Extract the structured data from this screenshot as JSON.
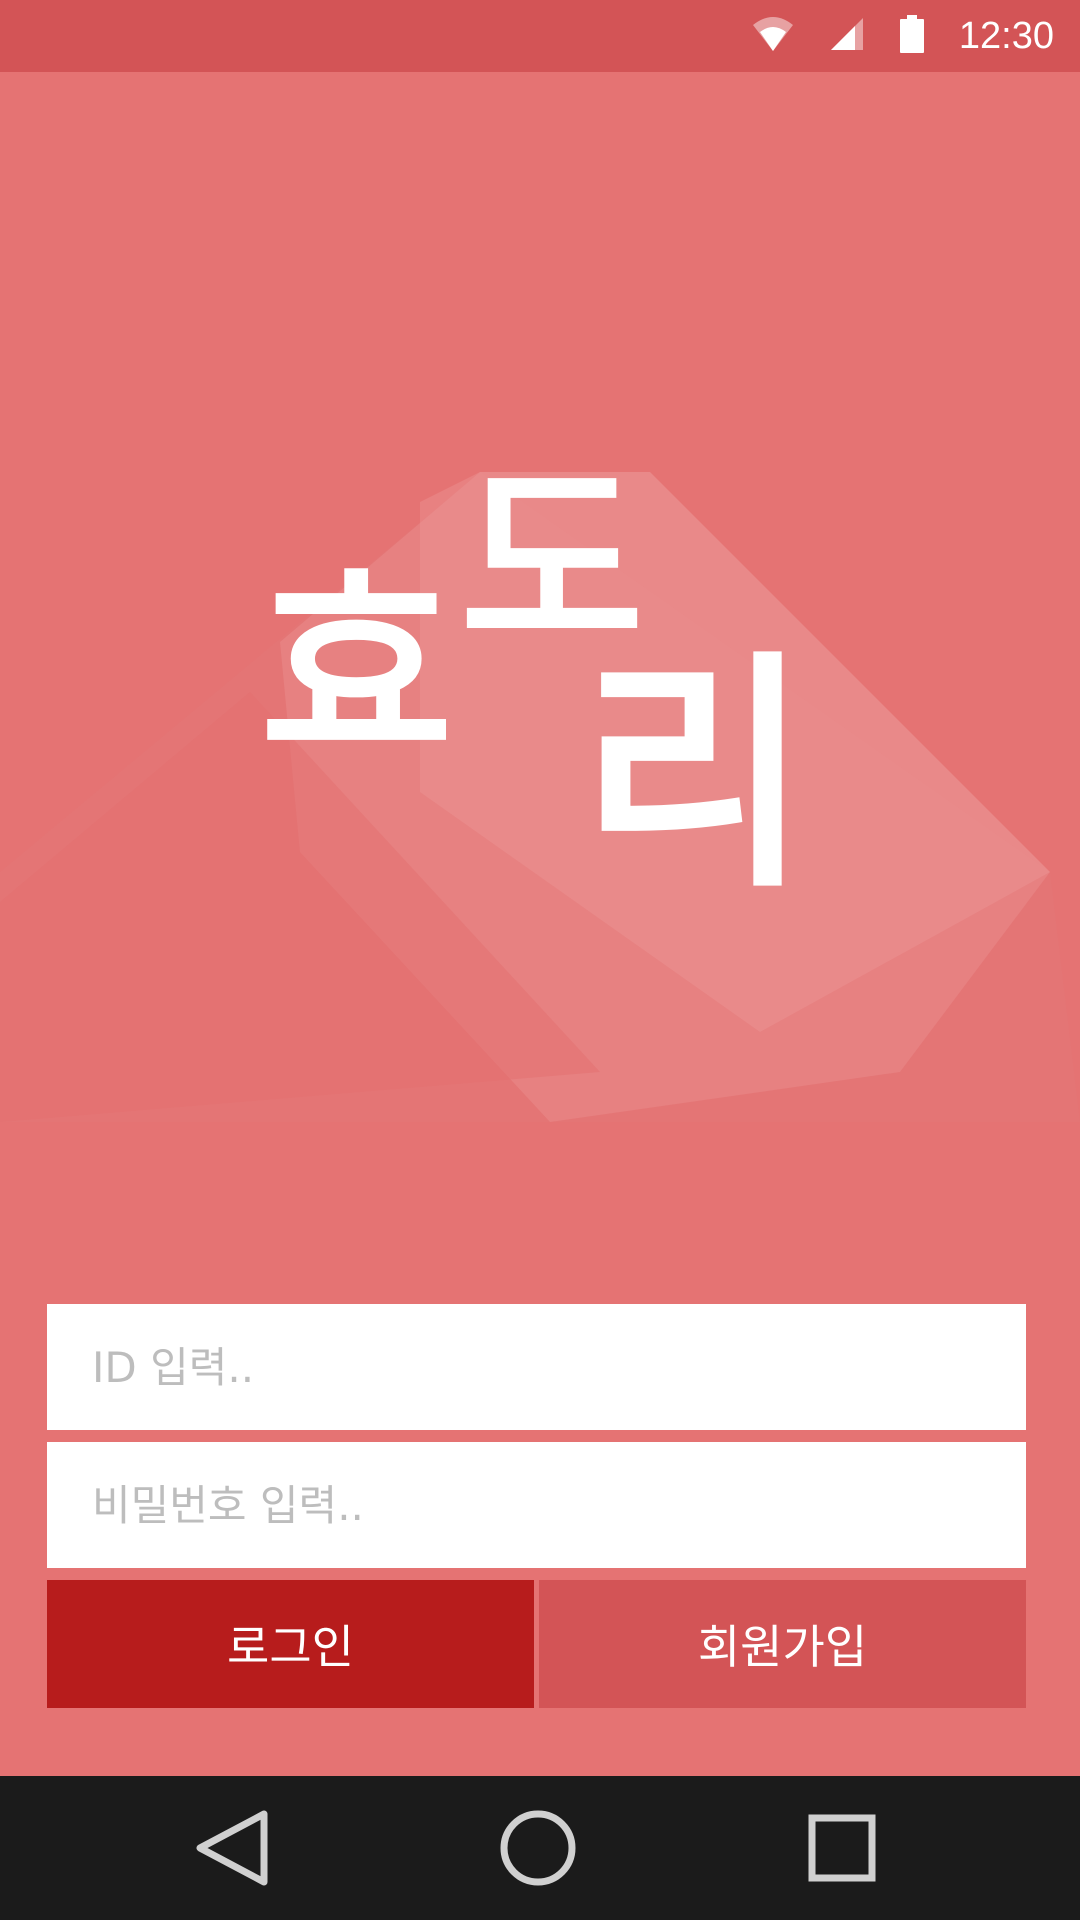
{
  "status_bar": {
    "time": "12:30",
    "icons": [
      "wifi-icon",
      "signal-icon",
      "battery-icon"
    ]
  },
  "logo": {
    "text": "효도리",
    "chars": [
      "효",
      "도",
      "리"
    ]
  },
  "form": {
    "id_placeholder": "ID 입력..",
    "password_placeholder": "비밀번호 입력..",
    "login_label": "로그인",
    "signup_label": "회원가입"
  },
  "nav_bar": {
    "icons": [
      "back-icon",
      "home-icon",
      "recents-icon"
    ]
  },
  "colors": {
    "background": "#e57373",
    "status_bar": "#d35456",
    "login_button": "#b71c1c",
    "signup_button": "#d35456",
    "nav_bar": "#1b1b1b"
  }
}
